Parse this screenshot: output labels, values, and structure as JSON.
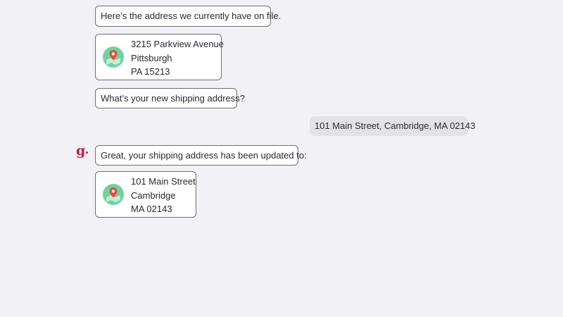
{
  "messages": {
    "m1": "Here’s the address we currently have on file.",
    "m2": "What’s your new shipping address?",
    "user_reply": "101 Main Street, Cambridge, MA 02143",
    "m3": "Great, your shipping address has been updated to:"
  },
  "old_address": {
    "line1": "3215 Parkview Avenue",
    "line2": "Pittsburgh",
    "line3": "PA 15213",
    "icon": "map-pin-icon"
  },
  "new_address": {
    "line1": "101 Main Street",
    "line2": "Cambridge",
    "line3": "MA 02143",
    "icon": "map-pin-icon"
  },
  "assistant": {
    "logo_text": "g",
    "logo_color": "#c8163d"
  },
  "colors": {
    "background": "#f2f1f6",
    "user_bubble": "#e3e2e8",
    "bubble_border": "#6e6e74",
    "map_green": "#6fd3a0",
    "pin_red": "#e64b3c"
  }
}
